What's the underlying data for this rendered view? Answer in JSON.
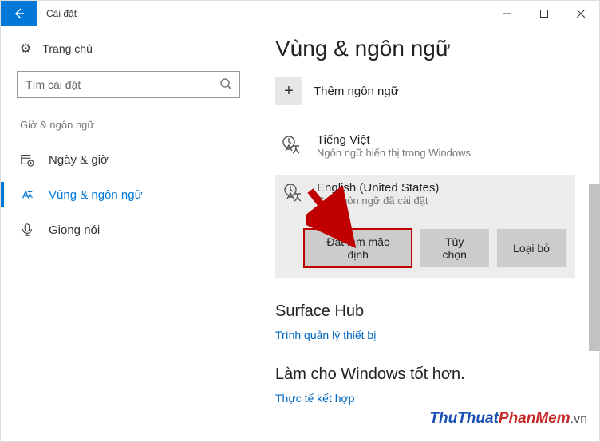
{
  "titlebar": {
    "title": "Cài đặt"
  },
  "sidebar": {
    "home": "Trang chủ",
    "search_placeholder": "Tìm cài đặt",
    "section_label": "Giờ & ngôn ngữ",
    "items": [
      {
        "label": "Ngày & giờ"
      },
      {
        "label": "Vùng & ngôn ngữ"
      },
      {
        "label": "Giọng nói"
      }
    ]
  },
  "main": {
    "page_title": "Vùng & ngôn ngữ",
    "add_language": "Thêm ngôn ngữ",
    "languages": [
      {
        "name": "Tiếng Việt",
        "desc": "Ngôn ngữ hiển thị trong Windows"
      },
      {
        "name": "English (United States)",
        "desc": "Gói ngôn ngữ đã cài đặt"
      }
    ],
    "buttons": {
      "set_default": "Đặt làm mặc định",
      "options": "Tùy chọn",
      "remove": "Loại bỏ"
    },
    "surface_hub": {
      "heading": "Surface Hub",
      "link": "Trình quản lý thiết bị"
    },
    "improve": {
      "heading": "Làm cho Windows tốt hơn.",
      "link": "Thực tế kết hợp"
    }
  },
  "watermark": {
    "part1": "ThuThuat",
    "part2": "PhanMem",
    "part3": ".vn"
  }
}
